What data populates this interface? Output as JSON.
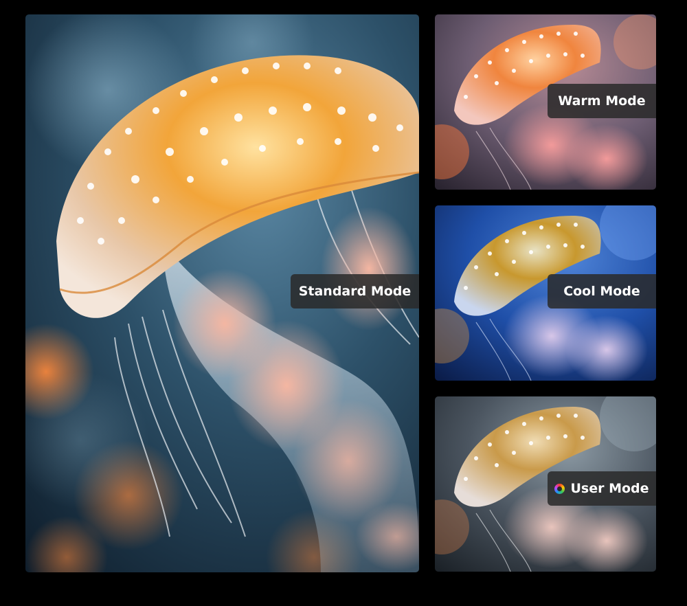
{
  "modes": {
    "standard": "Standard Mode",
    "warm": "Warm Mode",
    "cool": "Cool Mode",
    "user": "User Mode"
  },
  "icons": {
    "user_mode_icon": "rgb-color-wheel-icon"
  },
  "colors": {
    "background": "#000000",
    "label_background": "#2a2a2a",
    "label_text": "#ffffff",
    "standard_tone": "#2e4f66",
    "warm_tone": "#c9706a",
    "cool_tone": "#1f4fa8",
    "user_tone": "#4b5560"
  }
}
